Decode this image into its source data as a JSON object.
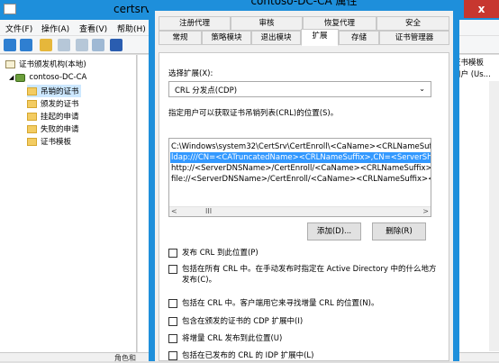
{
  "mmc": {
    "title": "certsrv",
    "menu": [
      "文件(F)",
      "操作(A)",
      "查看(V)",
      "帮助(H)"
    ],
    "close_label": "x",
    "tree": [
      {
        "label": "证书颁发机构(本地)",
        "icon": "cert-icon"
      },
      {
        "label": "contoso-DC-CA",
        "icon": "ca-icon"
      },
      {
        "label": "吊销的证书",
        "icon": "folder-icon"
      },
      {
        "label": "颁发的证书",
        "icon": "folder-icon"
      },
      {
        "label": "挂起的申请",
        "icon": "folder-icon"
      },
      {
        "label": "失败的申请",
        "icon": "folder-icon"
      },
      {
        "label": "证书模板",
        "icon": "folder-icon"
      }
    ],
    "right_columns": [
      "证书模板",
      "用户 (Us..."
    ],
    "status_text": "角色和"
  },
  "dialog": {
    "title": "contoso-DC-CA 属性",
    "tabs_row1": [
      "注册代理",
      "审核",
      "恢复代理",
      "安全"
    ],
    "tabs_row2": [
      "常规",
      "策略模块",
      "退出模块",
      "扩展",
      "存储",
      "证书管理器"
    ],
    "active_tab": "扩展",
    "select_ext_label": "选择扩展(X):",
    "select_ext_value": "CRL 分发点(CDP)",
    "description": "指定用户可以获取证书吊销列表(CRL)的位置(S)。",
    "locations": [
      "C:\\Windows\\system32\\CertSrv\\CertEnroll\\<CaName><CRLNameSuffix>",
      "ldap:///CN=<CATruncatedName><CRLNameSuffix>,CN=<ServerShort",
      "http://<ServerDNSName>/CertEnroll/<CaName><CRLNameSuffix><D",
      "file://<ServerDNSName>/CertEnroll/<CaName><CRLNameSuffix><De"
    ],
    "selected_location_index": 1,
    "scroll_thumb": "III",
    "add_button": "添加(D)...",
    "remove_button": "删除(R)",
    "checkboxes": [
      "发布 CRL 到此位置(P)",
      "包括在所有 CRL 中。在手动发布时指定在 Active Directory 中的什么地方发布(C)。",
      "包括在 CRL 中。客户端用它来寻找增量 CRL 的位置(N)。",
      "包含在颁发的证书的 CDP 扩展中(I)",
      "将增量 CRL 发布到此位置(U)",
      "包括在已发布的 CRL 的 IDP 扩展中(L)"
    ]
  }
}
